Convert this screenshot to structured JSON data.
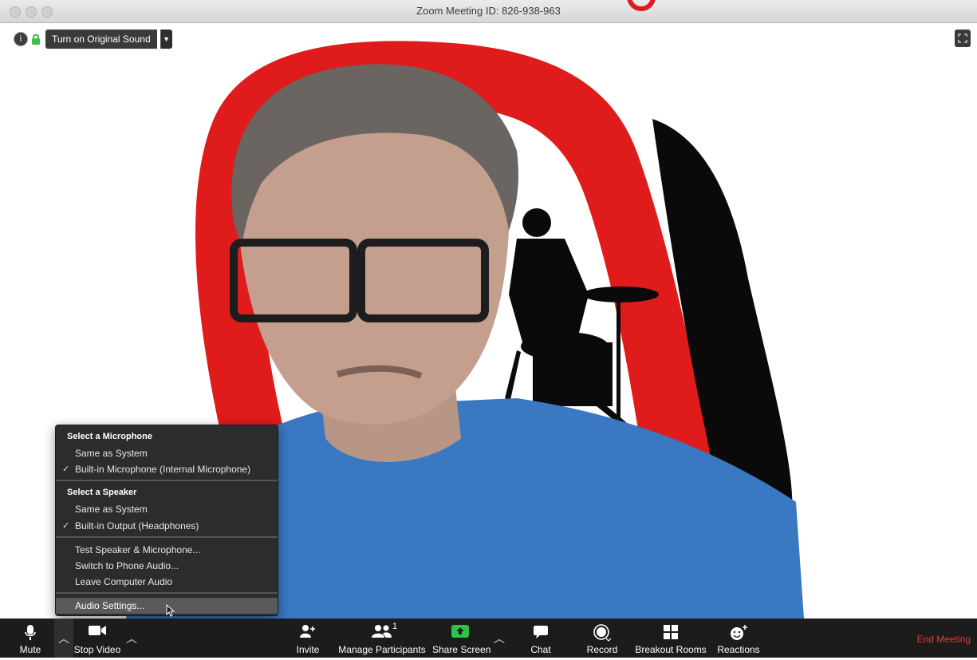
{
  "window": {
    "title": "Zoom Meeting ID: 826-938-963"
  },
  "top_overlay": {
    "original_sound_label": "Turn on Original Sound"
  },
  "audio_menu": {
    "microphone_header": "Select a Microphone",
    "mic_items": [
      {
        "label": "Same as System",
        "checked": false
      },
      {
        "label": "Built-in Microphone (Internal Microphone)",
        "checked": true
      }
    ],
    "speaker_header": "Select a Speaker",
    "speaker_items": [
      {
        "label": "Same as System",
        "checked": false
      },
      {
        "label": "Built-in Output (Headphones)",
        "checked": true
      }
    ],
    "actions": [
      {
        "label": "Test Speaker & Microphone..."
      },
      {
        "label": "Switch to Phone Audio..."
      },
      {
        "label": "Leave Computer Audio"
      }
    ],
    "audio_settings_label": "Audio Settings...",
    "check_glyph": "✓"
  },
  "toolbar": {
    "mute": "Mute",
    "stop_video": "Stop Video",
    "invite": "Invite",
    "manage_participants": "Manage Participants",
    "participant_count": "1",
    "share_screen": "Share Screen",
    "chat": "Chat",
    "record": "Record",
    "breakout_rooms": "Breakout Rooms",
    "reactions": "Reactions",
    "end_meeting": "End Meeting"
  },
  "colors": {
    "toolbar_bg": "#1c1c1c",
    "share_green": "#2ec44a",
    "end_red": "#e53935",
    "logo_red": "#e01b1b",
    "shirt_blue": "#3a78c2"
  }
}
